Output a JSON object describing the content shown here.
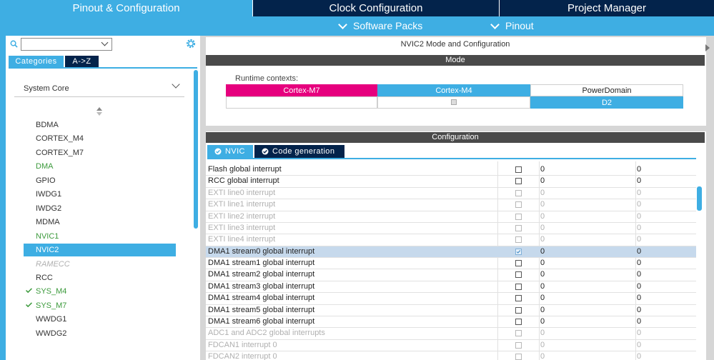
{
  "top_tabs": [
    {
      "label": "Pinout & Configuration",
      "active": true
    },
    {
      "label": "Clock Configuration",
      "active": false
    },
    {
      "label": "Project Manager",
      "active": false
    }
  ],
  "sub_menu": [
    {
      "label": "Software Packs"
    },
    {
      "label": "Pinout"
    }
  ],
  "left": {
    "search_value": "",
    "category_tabs": [
      {
        "label": "Categories"
      },
      {
        "label": "A->Z"
      }
    ],
    "group_label": "System Core",
    "items": [
      {
        "label": "BDMA",
        "state": "normal"
      },
      {
        "label": "CORTEX_M4",
        "state": "normal"
      },
      {
        "label": "CORTEX_M7",
        "state": "normal"
      },
      {
        "label": "DMA",
        "state": "ok"
      },
      {
        "label": "GPIO",
        "state": "normal"
      },
      {
        "label": "IWDG1",
        "state": "normal"
      },
      {
        "label": "IWDG2",
        "state": "normal"
      },
      {
        "label": "MDMA",
        "state": "normal"
      },
      {
        "label": "NVIC1",
        "state": "ok"
      },
      {
        "label": "NVIC2",
        "state": "selected"
      },
      {
        "label": "RAMECC",
        "state": "disabled"
      },
      {
        "label": "RCC",
        "state": "normal"
      },
      {
        "label": "SYS_M4",
        "state": "checked"
      },
      {
        "label": "SYS_M7",
        "state": "checked"
      },
      {
        "label": "WWDG1",
        "state": "normal"
      },
      {
        "label": "WWDG2",
        "state": "normal"
      }
    ]
  },
  "right": {
    "window_title": "NVIC2 Mode and Configuration",
    "mode_label": "Mode",
    "runtime_contexts_label": "Runtime contexts:",
    "runtime_headers": [
      "Cortex-M7",
      "Cortex-M4",
      "PowerDomain"
    ],
    "powerdomain_value": "D2",
    "configuration_label": "Configuration",
    "config_tabs": [
      {
        "label": "NVIC"
      },
      {
        "label": "Code generation"
      }
    ],
    "rows": [
      {
        "name": "Flash global interrupt",
        "enabled": false,
        "dim": false,
        "v1": "0",
        "v2": "0"
      },
      {
        "name": "RCC global interrupt",
        "enabled": false,
        "dim": false,
        "v1": "0",
        "v2": "0"
      },
      {
        "name": "EXTI line0 interrupt",
        "enabled": false,
        "dim": true,
        "v1": "0",
        "v2": "0"
      },
      {
        "name": "EXTI line1 interrupt",
        "enabled": false,
        "dim": true,
        "v1": "0",
        "v2": "0"
      },
      {
        "name": "EXTI line2 interrupt",
        "enabled": false,
        "dim": true,
        "v1": "0",
        "v2": "0"
      },
      {
        "name": "EXTI line3 interrupt",
        "enabled": false,
        "dim": true,
        "v1": "0",
        "v2": "0"
      },
      {
        "name": "EXTI line4 interrupt",
        "enabled": false,
        "dim": true,
        "v1": "0",
        "v2": "0"
      },
      {
        "name": "DMA1 stream0 global interrupt",
        "enabled": true,
        "dim": false,
        "highlight": true,
        "v1": "0",
        "v2": "0"
      },
      {
        "name": "DMA1 stream1 global interrupt",
        "enabled": false,
        "dim": false,
        "v1": "0",
        "v2": "0"
      },
      {
        "name": "DMA1 stream2 global interrupt",
        "enabled": false,
        "dim": false,
        "v1": "0",
        "v2": "0"
      },
      {
        "name": "DMA1 stream3 global interrupt",
        "enabled": false,
        "dim": false,
        "v1": "0",
        "v2": "0"
      },
      {
        "name": "DMA1 stream4 global interrupt",
        "enabled": false,
        "dim": false,
        "v1": "0",
        "v2": "0"
      },
      {
        "name": "DMA1 stream5 global interrupt",
        "enabled": false,
        "dim": false,
        "v1": "0",
        "v2": "0"
      },
      {
        "name": "DMA1 stream6 global interrupt",
        "enabled": false,
        "dim": false,
        "v1": "0",
        "v2": "0"
      },
      {
        "name": "ADC1 and ADC2 global interrupts",
        "enabled": false,
        "dim": true,
        "v1": "0",
        "v2": "0"
      },
      {
        "name": "FDCAN1 interrupt 0",
        "enabled": false,
        "dim": true,
        "v1": "0",
        "v2": "0"
      },
      {
        "name": "FDCAN2 interrupt 0",
        "enabled": false,
        "dim": true,
        "v1": "0",
        "v2": "0"
      }
    ]
  },
  "colors": {
    "navy": "#03234b",
    "accent": "#3eaee3",
    "magenta": "#e6007e",
    "ok_green": "#3c9a3c"
  },
  "icons": [
    "search-icon",
    "gear-icon",
    "chevron-down-icon",
    "sort-icon",
    "check-icon",
    "tab-check-icon",
    "expand-arrow-icon"
  ]
}
